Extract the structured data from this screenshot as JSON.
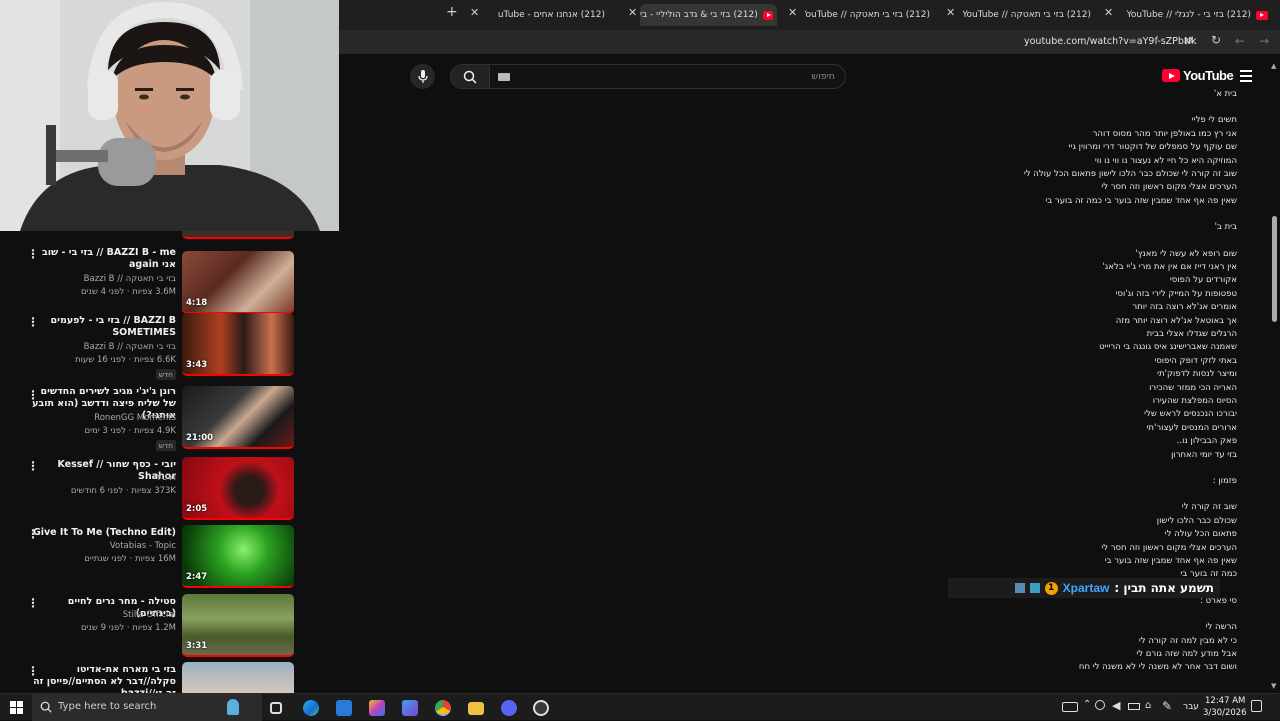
{
  "tabs": [
    {
      "title": "(212) בזי בי - לנגלי // YouTube"
    },
    {
      "title": "(212) בזי בי תאטקה // YouTube"
    },
    {
      "title": "(212) בזי בי תאטקה // YouTube"
    },
    {
      "title": "(212) בזי בי & גדב הוליליי - בי"
    },
    {
      "title": "(212) אנחנו אחים - YouTube"
    }
  ],
  "address": {
    "url": "youtube.com/watch?v=aY9f-sZPbNk"
  },
  "youtube": {
    "logo_text": "YouTube",
    "search_placeholder": "חיפוש"
  },
  "recommendations": [
    {
      "title": "BAZZI B - me // בזי בי - שוב אני again",
      "channel": "בזי בי תאטקה // Bazzi B",
      "meta": "3.6M צפיות · לפני 4 שנים",
      "duration": "4:18",
      "badge": ""
    },
    {
      "title": "BAZZI B // בזי בי - לפעמים SOMETIMES",
      "channel": "בזי בי תאטקה // Bazzi B",
      "meta": "6.6K צפיות · לפני 16 שעות",
      "duration": "3:43",
      "badge": "חדש"
    },
    {
      "title": "רונן ג'יג'י מגיב לשירים החדשים של שליח פיצה ודדשב (הוא תובע אותנו?)",
      "channel": "RonenGG Moments",
      "meta": "4.9K צפיות · לפני 3 ימים",
      "duration": "21:00",
      "badge": "חדש"
    },
    {
      "title": "יובי - כסף שחור // Kessef Shahor",
      "channel": "YUVI",
      "meta": "373K צפיות · לפני 6 חודשים",
      "duration": "2:05",
      "badge": ""
    },
    {
      "title": "Give It To Me (Techno Edit)",
      "channel": "Votabias - Topic",
      "meta": "16M צפיות · לפני שנתיים",
      "duration": "2:47",
      "badge": ""
    },
    {
      "title": "סטילה - מחר נרים לחיים (בינתיים)",
      "channel": "Stilla Official",
      "meta": "1.2M צפיות · לפני 9 שנים",
      "duration": "3:31",
      "badge": ""
    },
    {
      "title": "בזי בי מארח את-אדיטו סקלה//דבר לא הסתיים//פייסן זה זה זו//bazzi ...",
      "channel": "",
      "meta": "",
      "duration": "",
      "badge": ""
    }
  ],
  "lyrics": [
    "בית א'",
    "",
    "תשים לי פליי",
    "אני רץ כמו באולפן יותר מהר מסוס דוהר",
    "שם עוקף על סמפלים של דוקטור דרי ומרווין גיי",
    "המוזיקה היא כל חיי לא נעצור נו ווי נו ווי",
    "שוב זה קורה לי שכולם כבר הלכו לישון פתאום הכל עולה לי",
    "הערכים אצלי מקום ראשון וזה חסר לי",
    "שאין פה אף אחד שמבין שזה בוער בי כמה זה בוער בי",
    "",
    "בית ב'",
    "",
    "שום רופא לא עשה לי מאנץ'",
    "אין ראני דייז אם אין את מרי ג'יי בלאג'",
    "אקורדים על הפוסי",
    "טפטופות על המייק לירי בזה וג'וסי",
    "אומרים אנ'לא רוצה בזה יותר",
    "אך באוטאל אנ'לא רוצה יותר מזה",
    "הרגלים שגדלו אצלי בבית",
    "שאמנה שאברישינג איס גונגה בי הריייט",
    "באתי לזקי דופק היפוסי",
    "ומיצר לנסות לדפוק'תי",
    "האריה הכי ממזר שהכירו",
    "הסיוס המפלצת שהעירו",
    "יבורכו הנכנסים לראש שלי",
    "ארורים המנסים לעצור'תי",
    "פאק הבבילון נו..",
    "בזי עד יומי האחרון",
    "",
    "פזמון :",
    "",
    "שוב זה קורה לי",
    "שכולם כבר הלכו לישון",
    "פתאום הכל עולה לי",
    "הערכים אצלי מקום ראשון וזה חסר לי",
    "שאין פה אף אחד שמבין שזה בוער בי",
    "כמה זה בוער בי",
    "",
    "סי פארט :",
    "",
    "הרשה לי",
    "כי לא מבין למה זה קורה לי",
    "אבל מודע למה שזה גורם לי",
    "ושום דבר אחר לא משנה לי לא משנה לי חח"
  ],
  "overlay": {
    "username": "Xpartaw",
    "text": "תשמע אתה תבין :",
    "badge_count": "1"
  },
  "taskbar": {
    "search_placeholder": "Type here to search",
    "language": "עבר",
    "time": "12:47 AM",
    "date": "3/30/2026"
  },
  "colors": {
    "accent": "#ff0033",
    "background": "#0f0f0f",
    "username": "#3ea6ff"
  }
}
